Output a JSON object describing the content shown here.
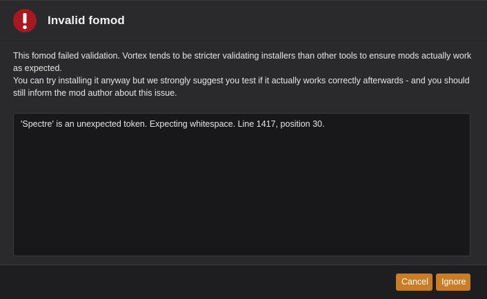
{
  "dialog": {
    "icon": "exclamation-icon",
    "title": "Invalid fomod",
    "colors": {
      "icon_red": "#a8191f",
      "button_accent": "#c97d26",
      "background": "#2a2a2c"
    }
  },
  "message": {
    "line1": "This fomod failed validation. Vortex tends to be stricter validating installers than other tools to ensure mods actually work as expected.",
    "line2": "You can try installing it anyway but we strongly suggest you test if it actually works correctly afterwards - and you should still inform the mod author about this issue."
  },
  "error_details": {
    "text": "'Spectre' is an unexpected token. Expecting whitespace. Line 1417, position 30."
  },
  "footer": {
    "cancel_label": "Cancel",
    "ignore_label": "Ignore"
  }
}
